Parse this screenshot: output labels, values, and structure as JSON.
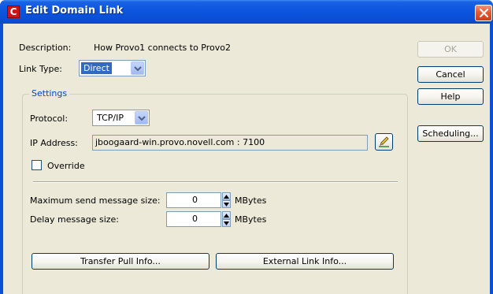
{
  "window": {
    "title": "Edit Domain Link",
    "app_icon_letter": "C"
  },
  "form": {
    "description_label": "Description:",
    "description_value": "How Provo1 connects to Provo2",
    "link_type_label": "Link Type:",
    "link_type_value": "Direct"
  },
  "settings": {
    "group_title": "Settings",
    "protocol_label": "Protocol:",
    "protocol_value": "TCP/IP",
    "ip_label": "IP Address:",
    "ip_value": "jboogaard-win.provo.novell.com : 7100",
    "override_label": "Override",
    "override_checked": false,
    "max_send_label": "Maximum send message size:",
    "max_send_value": "0",
    "max_send_unit": "MBytes",
    "delay_label": "Delay message size:",
    "delay_value": "0",
    "delay_unit": "MBytes",
    "transfer_pull_label": "Transfer Pull Info...",
    "external_link_label": "External Link Info..."
  },
  "buttons": {
    "ok": "OK",
    "cancel": "Cancel",
    "help": "Help",
    "scheduling": "Scheduling..."
  },
  "colors": {
    "titlebar": "#0a50d6",
    "close": "#e35b2f",
    "dialog_bg": "#ece9d8",
    "selection": "#316ac5",
    "group_title": "#0046d5"
  },
  "icons": {
    "app": "groupwise-c-icon",
    "close": "close-x-icon",
    "dropdown": "chevron-down-icon",
    "edit": "pencil-icon",
    "spinner": "spinner-arrows-icon"
  }
}
